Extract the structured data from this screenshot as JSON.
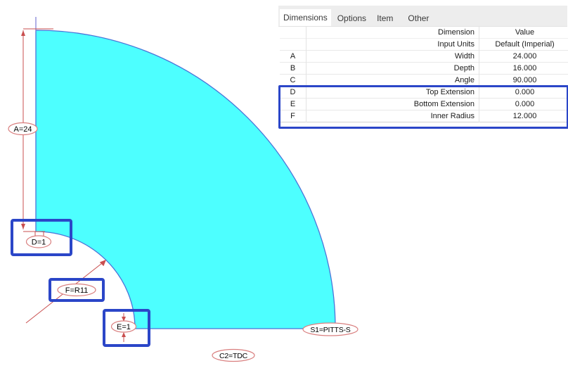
{
  "drawing": {
    "labels": {
      "a": "A=24",
      "d": "D=1",
      "f": "F=R11",
      "e": "E=1",
      "s1": "S1=PITTS-S",
      "c2": "C2=TDC"
    },
    "colors": {
      "shape_fill": "#4DFFFF",
      "shape_outline": "#4A74D8",
      "dimension_red": "#C94F4F",
      "highlight_blue": "#2B46C8"
    }
  },
  "panel": {
    "tabs": [
      {
        "label": "Dimensions",
        "selected": true
      },
      {
        "label": "Options",
        "selected": false
      },
      {
        "label": "Item",
        "selected": false
      },
      {
        "label": "Other",
        "selected": false
      }
    ],
    "header": {
      "dimension": "Dimension",
      "value": "Value",
      "input_units": "Input Units",
      "default_units": "Default (Imperial)"
    },
    "rows": [
      {
        "letter": "A",
        "dimension": "Width",
        "value": "24.000"
      },
      {
        "letter": "B",
        "dimension": "Depth",
        "value": "16.000"
      },
      {
        "letter": "C",
        "dimension": "Angle",
        "value": "90.000"
      },
      {
        "letter": "D",
        "dimension": "Top Extension",
        "value": "0.000"
      },
      {
        "letter": "E",
        "dimension": "Bottom Extension",
        "value": "0.000"
      },
      {
        "letter": "F",
        "dimension": "Inner Radius",
        "value": "12.000"
      }
    ]
  }
}
